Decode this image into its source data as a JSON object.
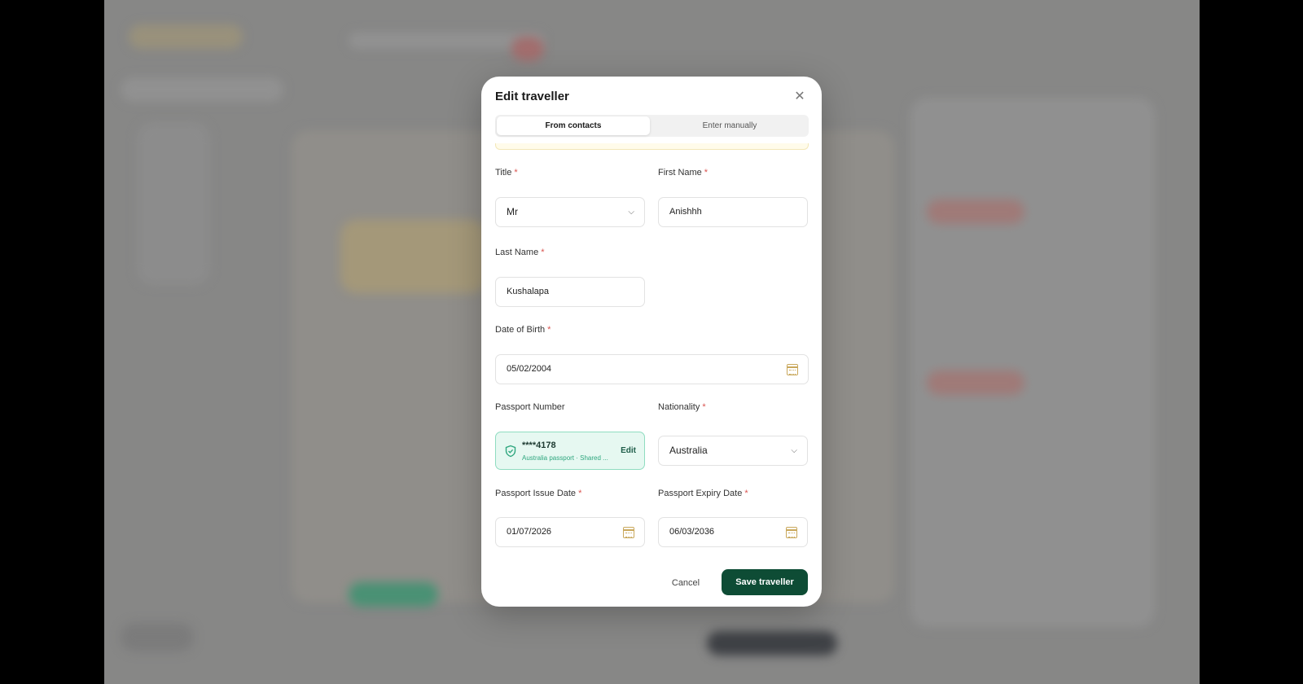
{
  "modal": {
    "title": "Edit traveller",
    "tabs": [
      {
        "label": "From contacts",
        "active": true
      },
      {
        "label": "Enter manually",
        "active": false
      }
    ]
  },
  "form": {
    "title": {
      "label": "Title",
      "value": "Mr"
    },
    "first_name": {
      "label": "First Name",
      "value": "Anishhh"
    },
    "last_name": {
      "label": "Last Name",
      "value": "Kushalapa"
    },
    "dob": {
      "label": "Date of Birth",
      "value": "05/02/2004"
    },
    "passport": {
      "label": "Passport Number",
      "masked": "****4178",
      "subtitle": "Australia passport · Shared ...",
      "edit_label": "Edit"
    },
    "nationality": {
      "label": "Nationality",
      "value": "Australia"
    },
    "issue_date": {
      "label": "Passport Issue Date",
      "value": "01/07/2026"
    },
    "expiry_date": {
      "label": "Passport Expiry Date",
      "value": "06/03/2036"
    },
    "required_mark": "*"
  },
  "actions": {
    "cancel": "Cancel",
    "save": "Save traveller"
  },
  "colors": {
    "primary": "#0e4c35",
    "required": "#d9534f",
    "verified_bg": "#e6f8f1",
    "verified_border": "#8fdcc0",
    "calendar": "#c9a85c"
  },
  "icons": {
    "close": "close-icon",
    "chevron": "chevron-down-icon",
    "calendar": "calendar-icon",
    "shield": "shield-check-icon"
  }
}
